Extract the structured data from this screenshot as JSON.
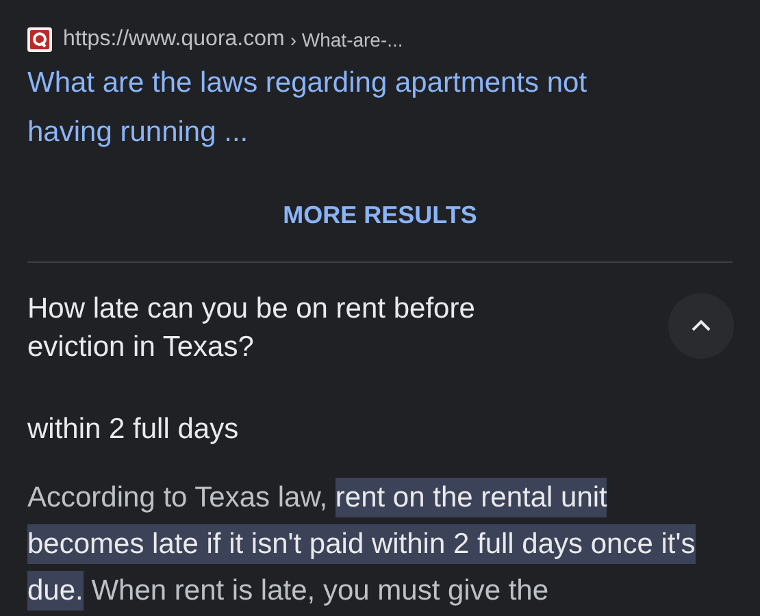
{
  "result": {
    "url": "https://www.quora.com",
    "breadcrumb": "› What-are-...",
    "title": "What are the laws regarding apartments not having running ..."
  },
  "more_results": "MORE RESULTS",
  "question": {
    "text": "How late can you be on rent before eviction in Texas?",
    "expanded": true,
    "short_answer": "within 2 full days",
    "answer": {
      "before": "According to Texas law, ",
      "highlighted": "rent on the rental unit becomes late if it isn't paid within 2 full days once it's due.",
      "after": " When rent is late, you must give the"
    }
  }
}
